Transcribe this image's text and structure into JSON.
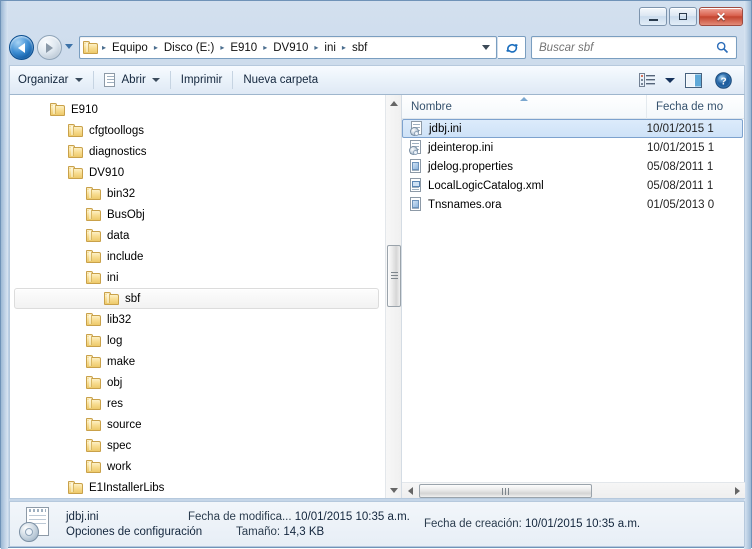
{
  "window": {
    "controls": {
      "minimize": "–",
      "maximize": "□",
      "close": "✕"
    }
  },
  "address": {
    "folder_icon": "folder-icon",
    "breadcrumbs": [
      "Equipo",
      "Disco (E:)",
      "E910",
      "DV910",
      "ini",
      "sbf"
    ],
    "separator": "▸",
    "dropdown_icon": "chevron-down-icon",
    "refresh_icon": "refresh-icon"
  },
  "search": {
    "placeholder": "Buscar sbf",
    "icon": "search-icon"
  },
  "toolbar": {
    "organize": "Organizar",
    "open": "Abrir",
    "print": "Imprimir",
    "new_folder": "Nueva carpeta",
    "view_icon": "view-options-icon",
    "preview_icon": "preview-pane-icon",
    "help_icon": "help-icon"
  },
  "tree": {
    "items": [
      {
        "label": "E910",
        "indent": 1,
        "selected": false
      },
      {
        "label": "cfgtoollogs",
        "indent": 2,
        "selected": false
      },
      {
        "label": "diagnostics",
        "indent": 2,
        "selected": false
      },
      {
        "label": "DV910",
        "indent": 2,
        "selected": false
      },
      {
        "label": "bin32",
        "indent": 3,
        "selected": false
      },
      {
        "label": "BusObj",
        "indent": 3,
        "selected": false
      },
      {
        "label": "data",
        "indent": 3,
        "selected": false
      },
      {
        "label": "include",
        "indent": 3,
        "selected": false
      },
      {
        "label": "ini",
        "indent": 3,
        "selected": false
      },
      {
        "label": "sbf",
        "indent": 4,
        "selected": true
      },
      {
        "label": "lib32",
        "indent": 3,
        "selected": false
      },
      {
        "label": "log",
        "indent": 3,
        "selected": false
      },
      {
        "label": "make",
        "indent": 3,
        "selected": false
      },
      {
        "label": "obj",
        "indent": 3,
        "selected": false
      },
      {
        "label": "res",
        "indent": 3,
        "selected": false
      },
      {
        "label": "source",
        "indent": 3,
        "selected": false
      },
      {
        "label": "spec",
        "indent": 3,
        "selected": false
      },
      {
        "label": "work",
        "indent": 3,
        "selected": false
      },
      {
        "label": "E1InstallerLibs",
        "indent": 2,
        "selected": false
      }
    ]
  },
  "filelist": {
    "columns": [
      {
        "key": "name",
        "label": "Nombre",
        "sorted": "asc"
      },
      {
        "key": "date",
        "label": "Fecha de mo"
      }
    ],
    "rows": [
      {
        "name": "jdbj.ini",
        "date": "10/01/2015 1",
        "icon": "config-file-icon",
        "selected": true
      },
      {
        "name": "jdeinterop.ini",
        "date": "10/01/2015 1",
        "icon": "config-file-icon",
        "selected": false
      },
      {
        "name": "jdelog.properties",
        "date": "05/08/2011 1",
        "icon": "document-file-icon",
        "selected": false
      },
      {
        "name": "LocalLogicCatalog.xml",
        "date": "05/08/2011 1",
        "icon": "xml-file-icon",
        "selected": false
      },
      {
        "name": "Tnsnames.ora",
        "date": "01/05/2013 0",
        "icon": "document-file-icon",
        "selected": false
      }
    ]
  },
  "details": {
    "file_icon": "config-file-icon",
    "file_name": "jdbj.ini",
    "file_type": "Opciones de configuración",
    "modified_label": "Fecha de modifica...",
    "modified_value": "10/01/2015 10:35 a.m.",
    "size_label": "Tamaño:",
    "size_value": "14,3 KB",
    "created_label": "Fecha de creación:",
    "created_value": "10/01/2015 10:35 a.m."
  }
}
